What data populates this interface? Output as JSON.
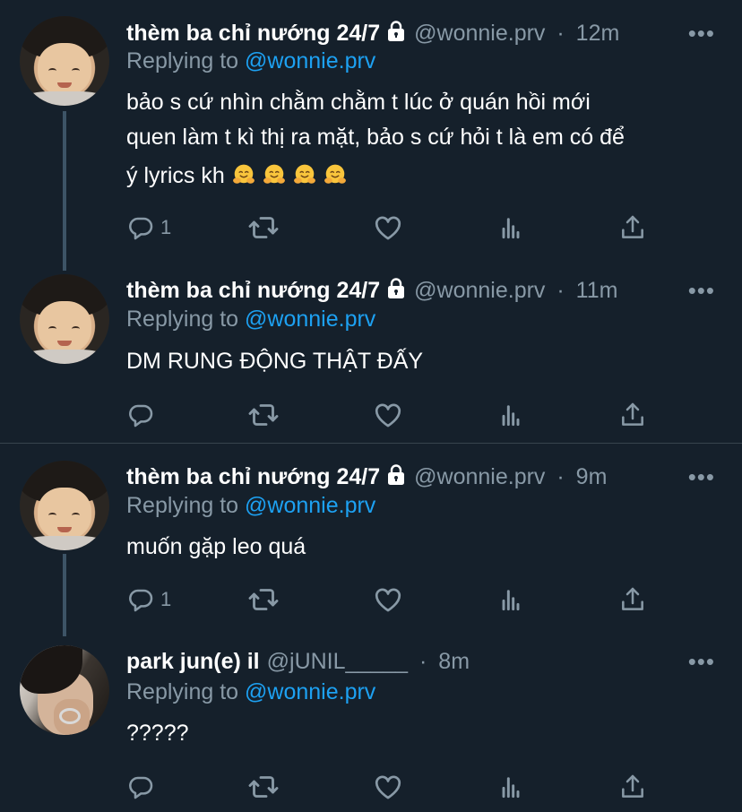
{
  "tweets": [
    {
      "name": "thèm ba chỉ nướng 24/7",
      "handle": "@wonnie.prv",
      "time": "12m",
      "replying_prefix": "Replying to",
      "replying_handle": "@wonnie.prv",
      "text_line1": "bảo s cứ nhìn chằm chằm t lúc ở quán hồi mới",
      "text_line2": "quen làm t kì thị ra mặt, bảo s cứ hỏi t là em có để",
      "text_line3": "ý lyrics kh",
      "emoji_count": 4,
      "reply_count": "1",
      "avatar": "baby-avatar",
      "locked": true
    },
    {
      "name": "thèm ba chỉ nướng 24/7",
      "handle": "@wonnie.prv",
      "time": "11m",
      "replying_prefix": "Replying to",
      "replying_handle": "@wonnie.prv",
      "text": "DM RUNG ĐỘNG THẬT ĐẤY",
      "reply_count": "",
      "avatar": "baby-avatar",
      "locked": true
    },
    {
      "name": "thèm ba chỉ nướng 24/7",
      "handle": "@wonnie.prv",
      "time": "9m",
      "replying_prefix": "Replying to",
      "replying_handle": "@wonnie.prv",
      "text": "muốn gặp leo quá",
      "reply_count": "1",
      "avatar": "baby-avatar",
      "locked": true
    },
    {
      "name": "park jun(e) il",
      "handle": "@jUNIL_____",
      "time": "8m",
      "replying_prefix": "Replying to",
      "replying_handle": "@wonnie.prv",
      "text": "?????",
      "reply_count": "",
      "avatar": "man-avatar",
      "locked": false
    }
  ],
  "separator": "·",
  "more_glyph": "•••",
  "icons": [
    "reply-icon",
    "retweet-icon",
    "like-icon",
    "analytics-icon",
    "share-icon",
    "lock-icon",
    "hugging-face-emoji"
  ],
  "colors": {
    "background": "#15202b",
    "text": "#ffffff",
    "muted": "#8899a6",
    "link": "#1da1f2",
    "thread_line": "#3d5466",
    "divider": "#38444d"
  }
}
